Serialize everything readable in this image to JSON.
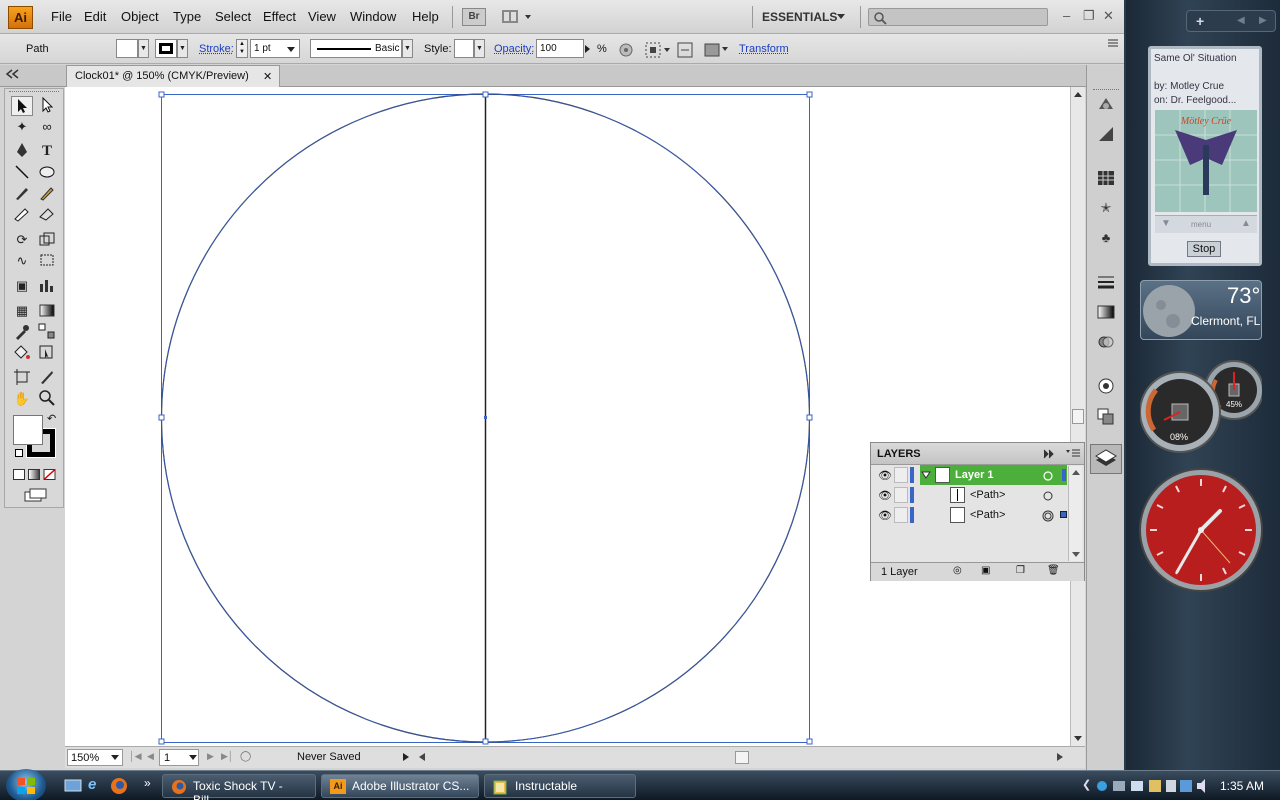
{
  "app": {
    "logo": "Ai",
    "menu": [
      "File",
      "Edit",
      "Object",
      "Type",
      "Select",
      "Effect",
      "View",
      "Window",
      "Help"
    ],
    "bridge_label": "Br",
    "workspace": "ESSENTIALS"
  },
  "control_bar": {
    "selection_type": "Path",
    "stroke_label": "Stroke:",
    "stroke_weight": "1 pt",
    "brush_style": "Basic",
    "style_label": "Style:",
    "opacity_label": "Opacity:",
    "opacity_value": "100",
    "opacity_unit": "%",
    "transform_link": "Transform"
  },
  "document": {
    "tab_title": "Clock01* @ 150% (CMYK/Preview)",
    "zoom": "150%",
    "artboard": "1",
    "save_status": "Never Saved"
  },
  "layers_panel": {
    "title": "LAYERS",
    "rows": [
      {
        "name": "Layer 1",
        "selected": true
      },
      {
        "name": "<Path>",
        "selected": false
      },
      {
        "name": "<Path>",
        "selected": false
      }
    ],
    "footer": "1 Layer"
  },
  "gadgets": {
    "media": {
      "song": "Same Ol' Situation",
      "artist": "by: Motley Crue",
      "album": "on: Dr. Feelgood...",
      "menu_label": "menu",
      "stop_label": "Stop"
    },
    "weather": {
      "temperature": "73°",
      "location": "Clermont, FL"
    },
    "cpu": {
      "cpu_percent": "08%",
      "memory_percent": "45%"
    }
  },
  "taskbar": {
    "tasks": [
      "Toxic Shock TV - Bill...",
      "Adobe Illustrator CS...",
      "Instructable"
    ],
    "clock": "1:35 AM"
  },
  "colors": {
    "accent_green": "#4caf3c",
    "selection_blue": "#3b64c8",
    "clock_red": "#b81e1e"
  }
}
